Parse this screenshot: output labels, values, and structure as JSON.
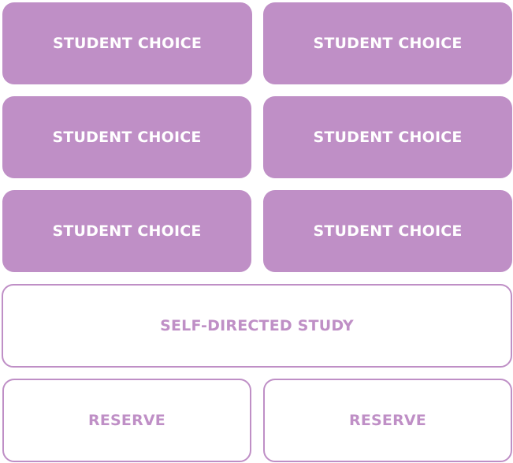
{
  "colors": {
    "accent": "#bf8fc6",
    "filled_text": "#ffffff",
    "background": "#ffffff"
  },
  "blocks": {
    "row1_left": "STUDENT CHOICE",
    "row1_right": "STUDENT CHOICE",
    "row2_left": "STUDENT CHOICE",
    "row2_right": "STUDENT CHOICE",
    "row3_left": "STUDENT CHOICE",
    "row3_right": "STUDENT CHOICE",
    "self_directed": "SELF-DIRECTED STUDY",
    "reserve_left": "RESERVE",
    "reserve_right": "RESERVE"
  }
}
